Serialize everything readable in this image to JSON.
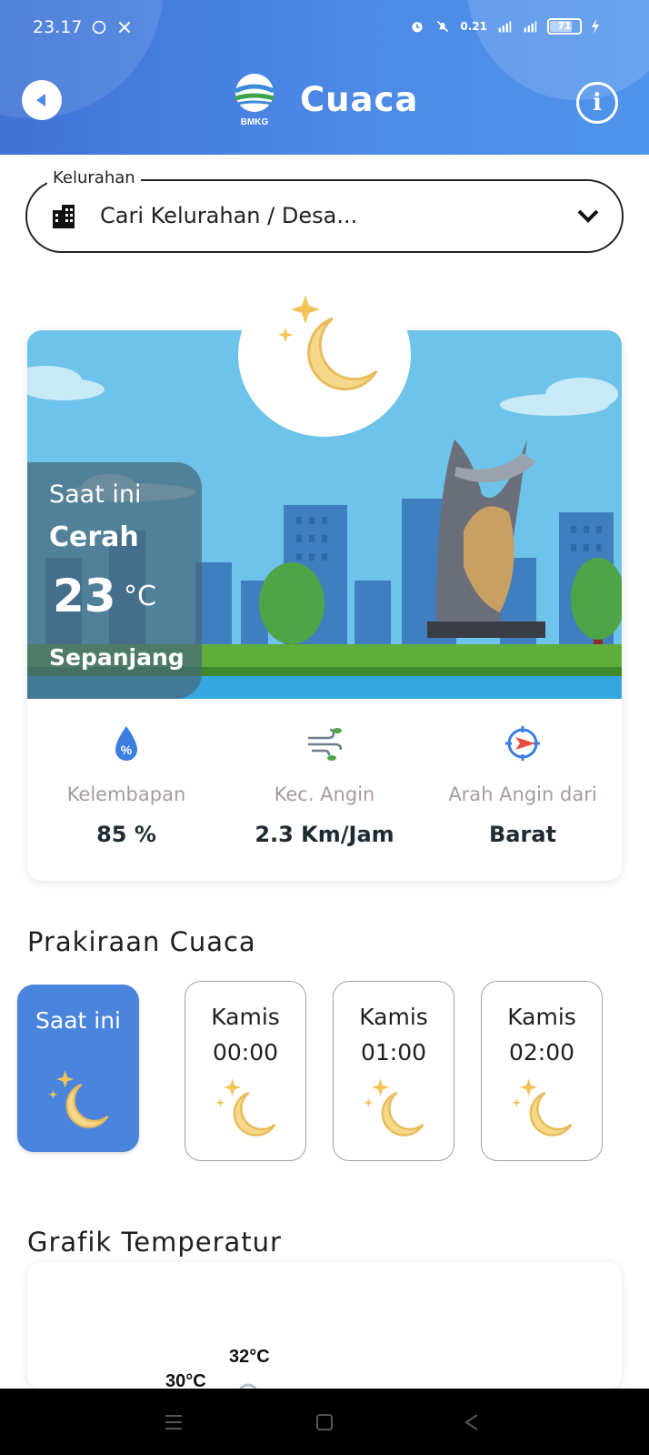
{
  "status_bar": {
    "time": "23.17",
    "network_speed": "0.21",
    "battery": "71",
    "icons": [
      "whatsapp-icon",
      "x-icon",
      "alarm-icon",
      "mute-icon",
      "wifi-icon",
      "signal-icon",
      "battery-icon",
      "charging-icon"
    ]
  },
  "header": {
    "title": "Cuaca",
    "logo_text": "BMKG",
    "back_icon": "back-icon",
    "info_icon": "info-icon"
  },
  "search": {
    "label": "Kelurahan",
    "placeholder": "Cari Kelurahan / Desa..."
  },
  "current": {
    "label": "Saat ini",
    "condition": "Cerah",
    "temperature": "23",
    "unit": "°C",
    "location": "Sepanjang"
  },
  "stats": [
    {
      "label": "Kelembapan",
      "value": "85 %",
      "icon": "humidity-icon"
    },
    {
      "label": "Kec. Angin",
      "value": "2.3 Km/Jam",
      "icon": "wind-icon"
    },
    {
      "label": "Arah Angin dari",
      "value": "Barat",
      "icon": "compass-icon"
    }
  ],
  "forecast": {
    "title": "Prakiraan Cuaca",
    "items": [
      {
        "day": "Saat ini",
        "time": ""
      },
      {
        "day": "Kamis",
        "time": "00:00"
      },
      {
        "day": "Kamis",
        "time": "01:00"
      },
      {
        "day": "Kamis",
        "time": "02:00"
      }
    ]
  },
  "chart": {
    "title": "Grafik Temperatur",
    "labels": [
      "30°C",
      "32°C"
    ]
  },
  "colors": {
    "header": "#4a84dc",
    "accent": "#4a84dc",
    "moon": "#f5d88a"
  }
}
